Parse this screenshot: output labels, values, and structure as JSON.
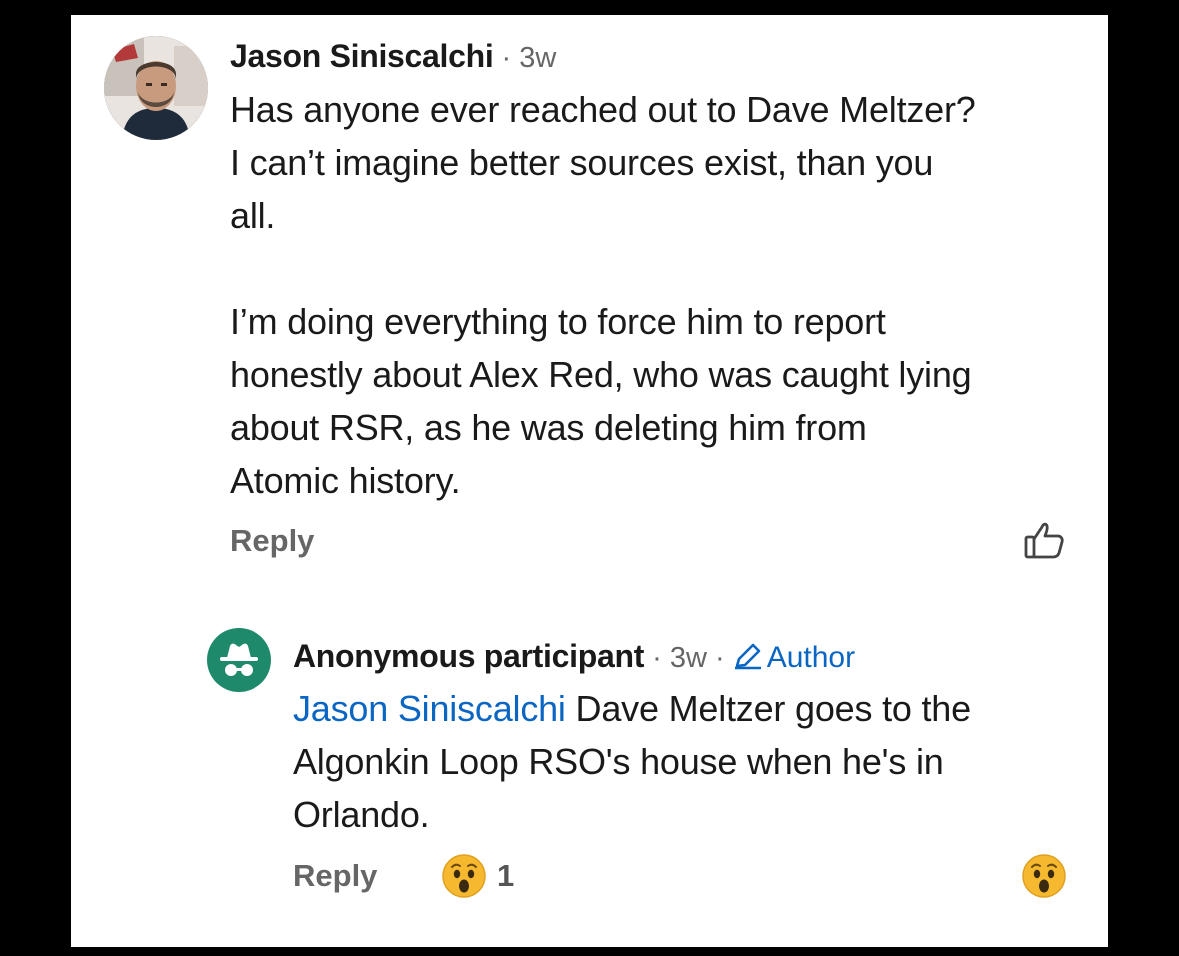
{
  "comments": [
    {
      "author": "Jason Siniscalchi",
      "meta": " · 3w",
      "body": "Has anyone ever reached out to Dave Meltzer?\nI can’t imagine better sources exist, than you\nall.\n\nI’m doing everything to force him to report\nhonestly about Alex Red, who was caught lying\nabout RSR, as he was deleting him from\nAtomic history.",
      "reply_label": "Reply",
      "icons": {
        "avatar": "profile-photo",
        "like": "thumbs-up-icon"
      }
    }
  ],
  "reply": {
    "author": "Anonymous participant",
    "meta": " · 3w · ",
    "badge": "Author",
    "mention": "Jason Siniscalchi",
    "body": " Dave Meltzer goes to the\nAlgonkin Loop RSO's house when he's in\nOrlando.",
    "reply_label": "Reply",
    "reaction_count": "1",
    "icons": {
      "avatar": "incognito-icon",
      "badge": "pencil-icon",
      "reaction": "surprised-face-icon"
    }
  },
  "colors": {
    "link": "#0a66c2",
    "anon_avatar": "#1f8a6b",
    "muted_text": "#666666",
    "emoji": "#f5b82e"
  }
}
